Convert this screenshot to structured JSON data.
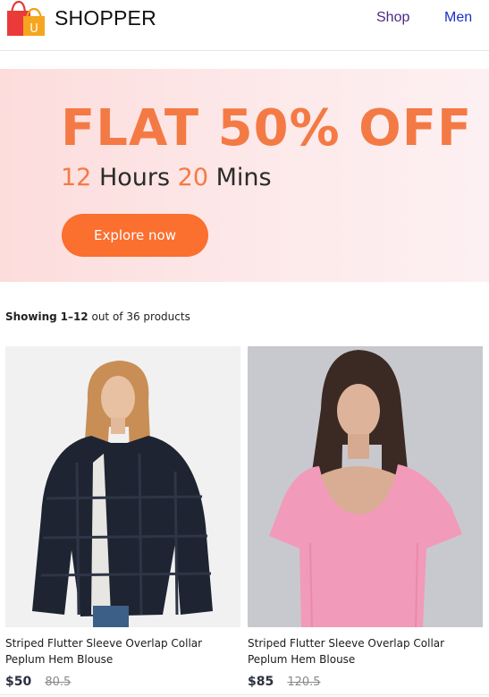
{
  "header": {
    "brand": "SHOPPER",
    "logo_letter": "U",
    "nav": {
      "shop": "Shop",
      "men": "Men"
    }
  },
  "banner": {
    "headline": "FLAT 50% OFF",
    "timer": {
      "hours": "12",
      "hours_label": "Hours",
      "mins": "20",
      "mins_label": "Mins"
    },
    "cta": "Explore now"
  },
  "results": {
    "showing_label": "Showing",
    "range": "1–12",
    "suffix": "out of 36 products"
  },
  "products": [
    {
      "title": "Striped Flutter Sleeve Overlap Collar Peplum Hem Blouse",
      "price": "$50",
      "old_price": "80.5"
    },
    {
      "title": "Striped Flutter Sleeve Overlap Collar Peplum Hem Blouse",
      "price": "$85",
      "old_price": "120.5"
    }
  ],
  "colors": {
    "accent": "#fb6f2f",
    "headline": "#f47a45",
    "banner_bg": "#fddcdc"
  }
}
